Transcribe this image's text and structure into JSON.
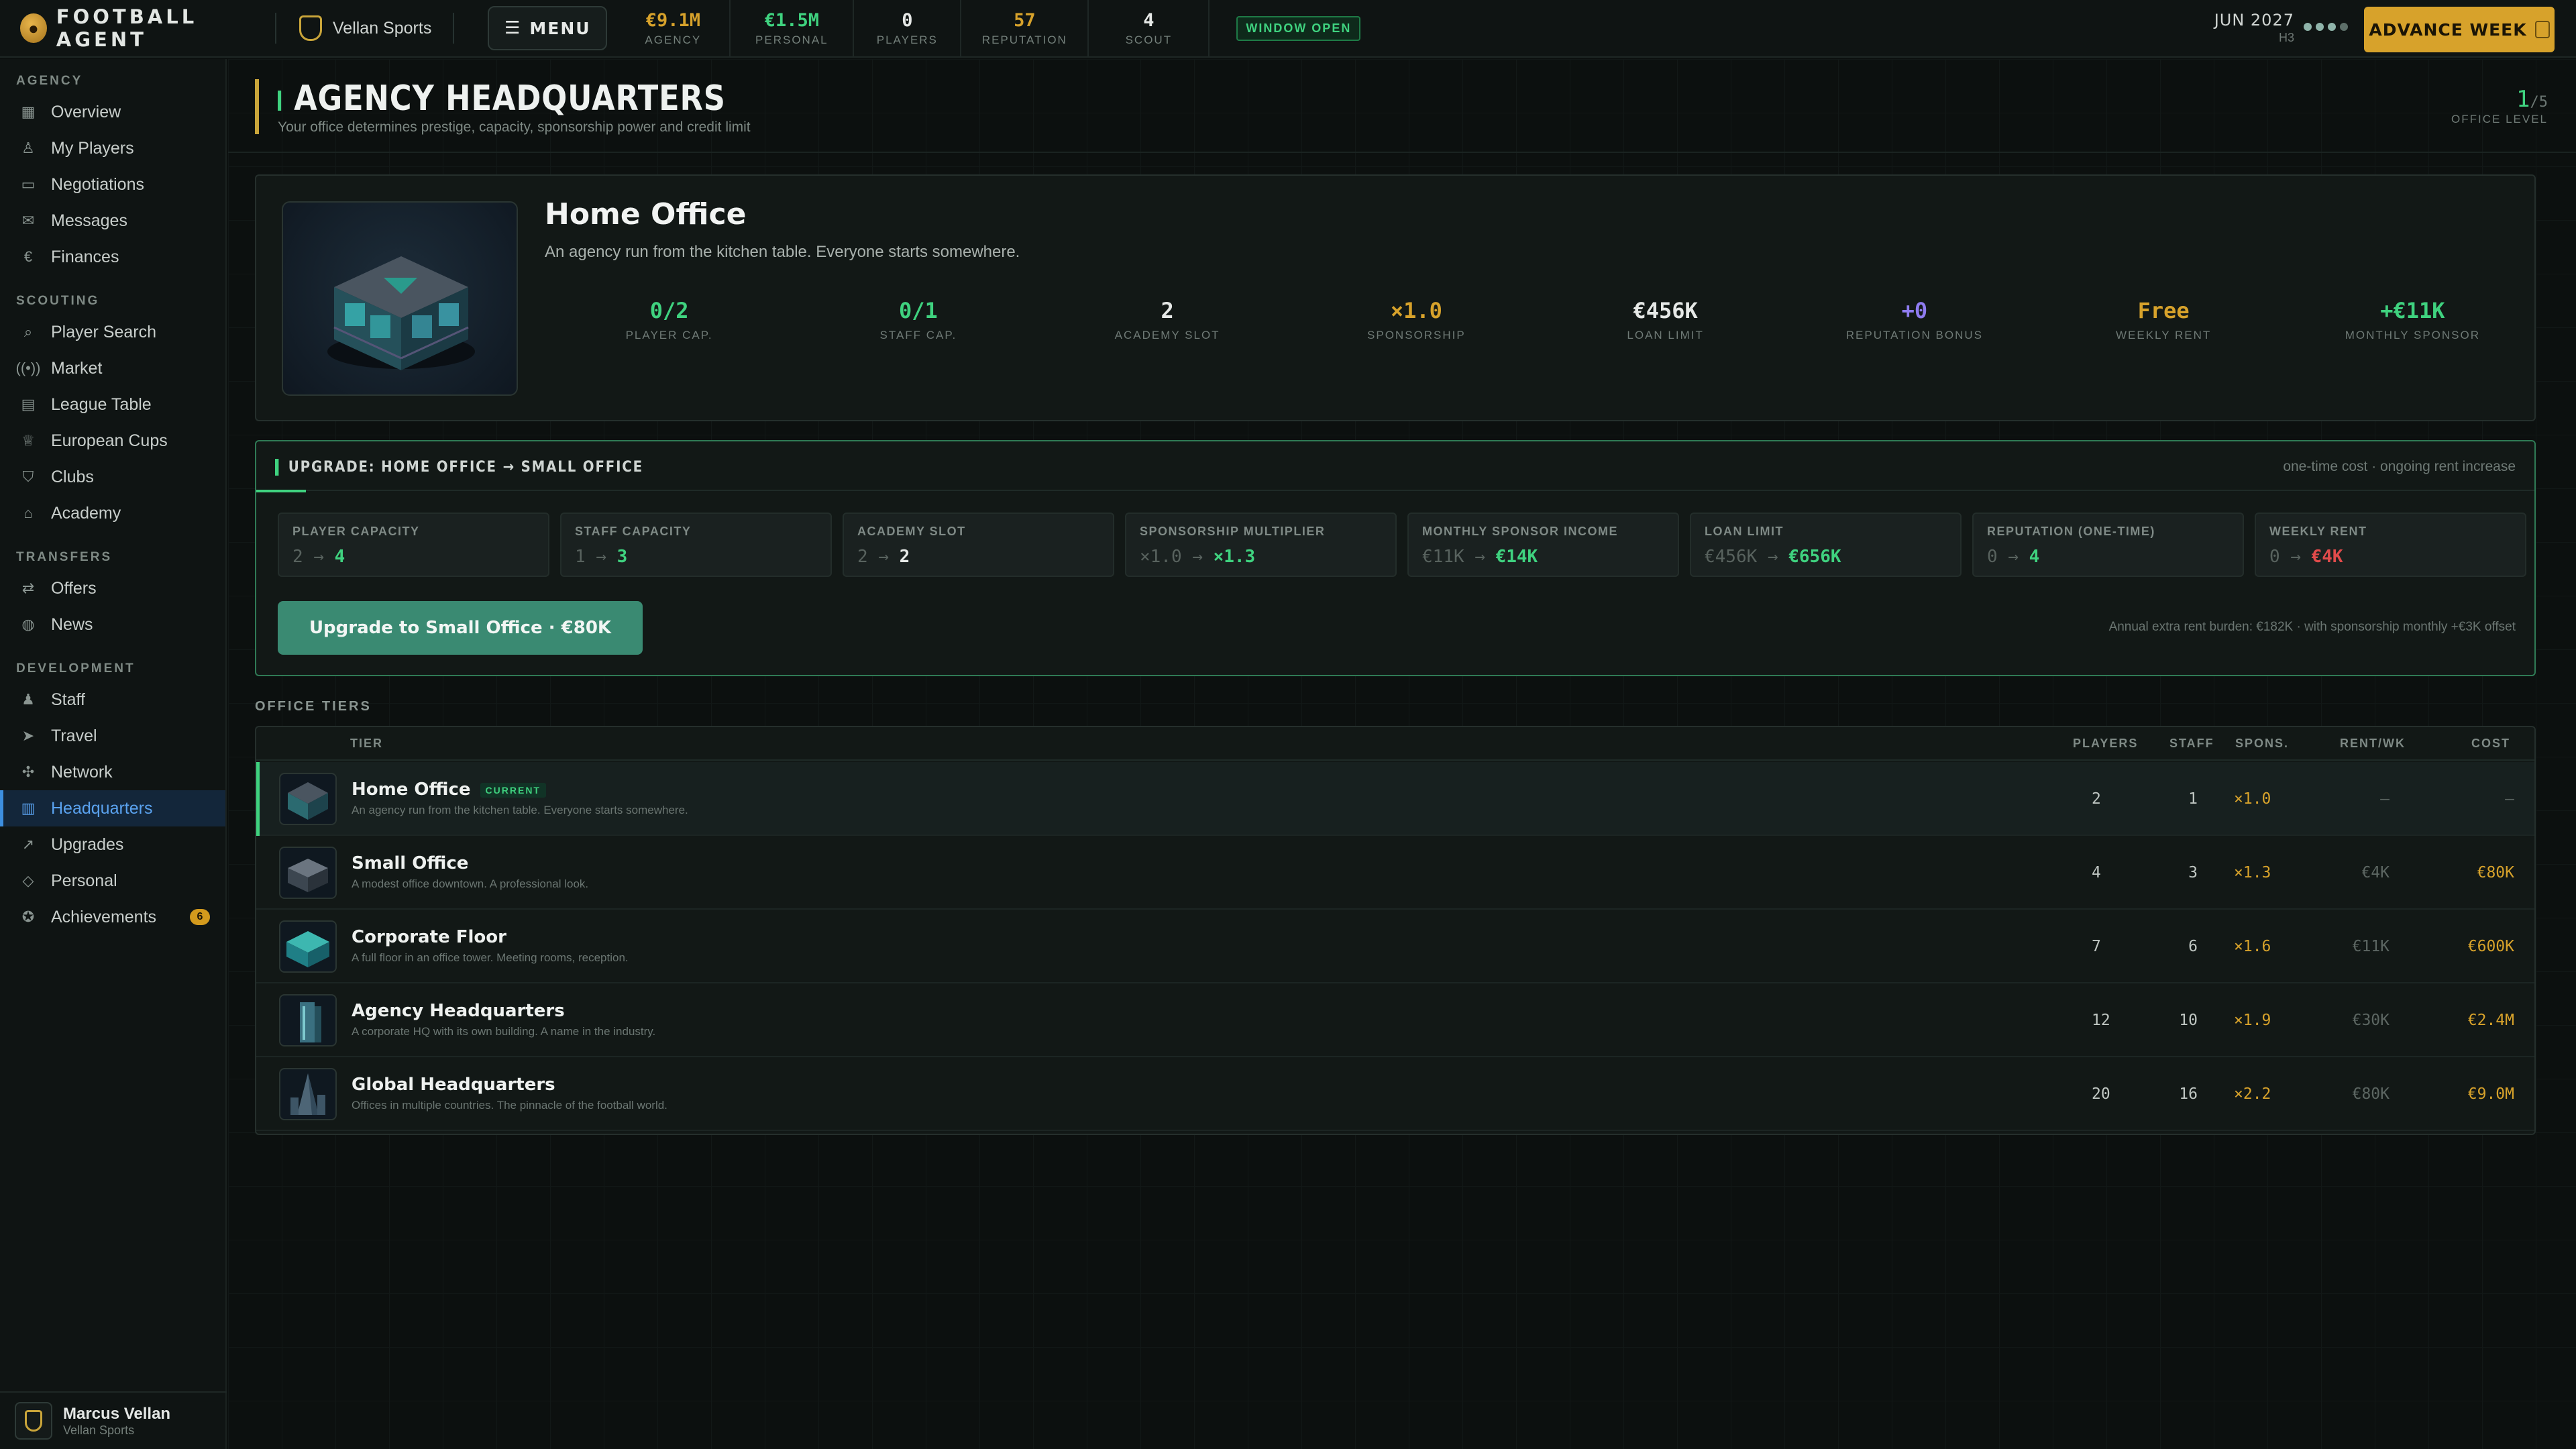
{
  "topbar": {
    "brand": "FOOTBALL AGENT",
    "agency_name": "Vellan Sports",
    "menu_label": "MENU",
    "stats": [
      {
        "value": "€9.1M",
        "label": "AGENCY",
        "color": "#d7a22b"
      },
      {
        "value": "€1.5M",
        "label": "PERSONAL",
        "color": "#3fd27f"
      },
      {
        "value": "0",
        "label": "PLAYERS",
        "color": "#e6e9e7"
      },
      {
        "value": "57",
        "label": "REPUTATION",
        "color": "#d7a22b"
      },
      {
        "value": "4",
        "label": "SCOUT",
        "color": "#e6e9e7"
      }
    ],
    "window_badge": "WINDOW OPEN",
    "date": "JUN 2027",
    "half": "H3",
    "advance_label": "ADVANCE WEEK"
  },
  "sidebar": {
    "sections": [
      {
        "title": "AGENCY",
        "items": [
          {
            "label": "Overview",
            "icon": "grid-icon"
          },
          {
            "label": "My Players",
            "icon": "user-icon"
          },
          {
            "label": "Negotiations",
            "icon": "chat-icon"
          },
          {
            "label": "Messages",
            "icon": "mail-icon"
          },
          {
            "label": "Finances",
            "icon": "euro-icon"
          }
        ]
      },
      {
        "title": "SCOUTING",
        "items": [
          {
            "label": "Player Search",
            "icon": "search-icon"
          },
          {
            "label": "Market",
            "icon": "broadcast-icon"
          },
          {
            "label": "League Table",
            "icon": "table-icon"
          },
          {
            "label": "European Cups",
            "icon": "trophy-icon"
          },
          {
            "label": "Clubs",
            "icon": "shield-icon"
          },
          {
            "label": "Academy",
            "icon": "graduation-icon"
          }
        ]
      },
      {
        "title": "TRANSFERS",
        "items": [
          {
            "label": "Offers",
            "icon": "swap-icon"
          },
          {
            "label": "News",
            "icon": "globe-icon"
          }
        ]
      },
      {
        "title": "DEVELOPMENT",
        "items": [
          {
            "label": "Staff",
            "icon": "team-icon"
          },
          {
            "label": "Travel",
            "icon": "plane-icon"
          },
          {
            "label": "Network",
            "icon": "network-icon"
          },
          {
            "label": "Headquarters",
            "icon": "building-icon",
            "active": true
          },
          {
            "label": "Upgrades",
            "icon": "trend-icon"
          },
          {
            "label": "Personal",
            "icon": "gem-icon"
          },
          {
            "label": "Achievements",
            "icon": "medal-icon",
            "badge": "6"
          }
        ]
      }
    ],
    "user": {
      "name": "Marcus Vellan",
      "org": "Vellan Sports"
    }
  },
  "page": {
    "title": "AGENCY HEADQUARTERS",
    "subtitle": "Your office determines prestige, capacity, sponsorship power and credit limit",
    "office_level": "1",
    "office_level_max": "/5",
    "office_level_label": "OFFICE LEVEL"
  },
  "hero": {
    "name": "Home Office",
    "desc": "An agency run from the kitchen table. Everyone starts somewhere.",
    "stats": [
      {
        "value": "0/2",
        "label": "PLAYER CAP.",
        "color": "#3fd27f"
      },
      {
        "value": "0/1",
        "label": "STAFF CAP.",
        "color": "#3fd27f"
      },
      {
        "value": "2",
        "label": "ACADEMY SLOT",
        "color": "#e6e9e7"
      },
      {
        "value": "×1.0",
        "label": "SPONSORSHIP",
        "color": "#d7a22b"
      },
      {
        "value": "€456K",
        "label": "LOAN LIMIT",
        "color": "#e6e9e7"
      },
      {
        "value": "+0",
        "label": "REPUTATION BONUS",
        "color": "#8f7cf0"
      },
      {
        "value": "Free",
        "label": "WEEKLY RENT",
        "color": "#d7a22b"
      },
      {
        "value": "+€11K",
        "label": "MONTHLY SPONSOR",
        "color": "#3fd27f"
      }
    ]
  },
  "upgrade": {
    "title": "UPGRADE: HOME OFFICE → SMALL OFFICE",
    "note": "one-time cost · ongoing rent increase",
    "chips": [
      {
        "label": "PLAYER CAPACITY",
        "from": "2",
        "to": "4",
        "color": "#3fd27f"
      },
      {
        "label": "STAFF CAPACITY",
        "from": "1",
        "to": "3",
        "color": "#3fd27f"
      },
      {
        "label": "ACADEMY SLOT",
        "from": "2",
        "to": "2",
        "color": "#e6e9e7"
      },
      {
        "label": "SPONSORSHIP MULTIPLIER",
        "from": "×1.0",
        "to": "×1.3",
        "color": "#3fd27f"
      },
      {
        "label": "MONTHLY SPONSOR INCOME",
        "from": "€11K",
        "to": "€14K",
        "color": "#3fd27f"
      },
      {
        "label": "LOAN LIMIT",
        "from": "€456K",
        "to": "€656K",
        "color": "#3fd27f"
      },
      {
        "label": "REPUTATION (ONE-TIME)",
        "from": "0",
        "to": "4",
        "color": "#3fd27f"
      },
      {
        "label": "WEEKLY RENT",
        "from": "0",
        "to": "€4K",
        "color": "#e24b4b"
      }
    ],
    "button_label": "Upgrade to Small Office · €80K",
    "burden": "Annual extra rent burden: €182K · with sponsorship monthly +€3K offset"
  },
  "tiers": {
    "section_label": "OFFICE TIERS",
    "headers": {
      "tier": "TIER",
      "players": "PLAYERS",
      "staff": "STAFF",
      "spons": "SPONS.",
      "rent": "RENT/WK",
      "cost": "COST"
    },
    "current_tag": "CURRENT",
    "rows": [
      {
        "name": "Home Office",
        "desc": "An agency run from the kitchen table. Everyone starts somewhere.",
        "players": "2",
        "staff": "1",
        "spons": "×1.0",
        "rent": "—",
        "cost": "—",
        "current": true,
        "icon": "house-icon"
      },
      {
        "name": "Small Office",
        "desc": "A modest office downtown. A professional look.",
        "players": "4",
        "staff": "3",
        "spons": "×1.3",
        "rent": "€4K",
        "cost": "€80K",
        "icon": "small-building-icon"
      },
      {
        "name": "Corporate Floor",
        "desc": "A full floor in an office tower. Meeting rooms, reception.",
        "players": "7",
        "staff": "6",
        "spons": "×1.6",
        "rent": "€11K",
        "cost": "€600K",
        "icon": "corporate-floor-icon"
      },
      {
        "name": "Agency Headquarters",
        "desc": "A corporate HQ with its own building. A name in the industry.",
        "players": "12",
        "staff": "10",
        "spons": "×1.9",
        "rent": "€30K",
        "cost": "€2.4M",
        "icon": "tower-icon"
      },
      {
        "name": "Global Headquarters",
        "desc": "Offices in multiple countries. The pinnacle of the football world.",
        "players": "20",
        "staff": "16",
        "spons": "×2.2",
        "rent": "€80K",
        "cost": "€9.0M",
        "icon": "skyscraper-icon"
      }
    ]
  }
}
